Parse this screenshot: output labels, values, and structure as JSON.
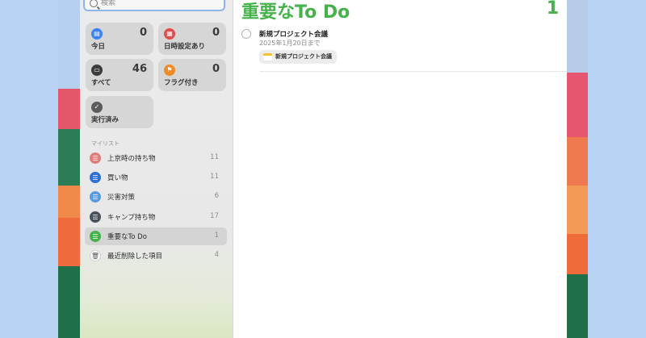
{
  "search": {
    "placeholder": "検索"
  },
  "smart_lists": [
    {
      "label": "今日",
      "count": "0",
      "icon": "calendar-icon",
      "color": "#3b82f6"
    },
    {
      "label": "日時設定あり",
      "count": "0",
      "icon": "calendar-clock-icon",
      "color": "#e24b4b"
    },
    {
      "label": "すべて",
      "count": "46",
      "icon": "tray-icon",
      "color": "#3b3b3b"
    },
    {
      "label": "フラグ付き",
      "count": "0",
      "icon": "flag-icon",
      "color": "#f08a24"
    },
    {
      "label": "実行済み",
      "count": "",
      "icon": "checkmark-icon",
      "color": "#5c5c5c"
    }
  ],
  "my_lists_title": "マイリスト",
  "my_lists": [
    {
      "name": "上京時の持ち物",
      "count": "11",
      "color": "#e07e7e",
      "icon": "list-icon"
    },
    {
      "name": "買い物",
      "count": "11",
      "color": "#2f6fd6",
      "icon": "list-icon"
    },
    {
      "name": "災害対策",
      "count": "6",
      "color": "#5a9be0",
      "icon": "list-icon"
    },
    {
      "name": "キャンプ持ち物",
      "count": "17",
      "color": "#4a4f5c",
      "icon": "list-icon"
    },
    {
      "name": "重要なTo Do",
      "count": "1",
      "color": "#46b24c",
      "icon": "list-icon",
      "selected": true
    },
    {
      "name": "最近削除した項目",
      "count": "4",
      "color": "#ffffff",
      "icon": "trash-icon"
    }
  ],
  "main": {
    "title": "重要なTo Do",
    "count": "1",
    "accent": "#46b24c",
    "tasks": [
      {
        "title": "新規プロジェクト会議",
        "due": "2025年1月20日まで",
        "tag": "新規プロジェクト会議"
      }
    ]
  }
}
